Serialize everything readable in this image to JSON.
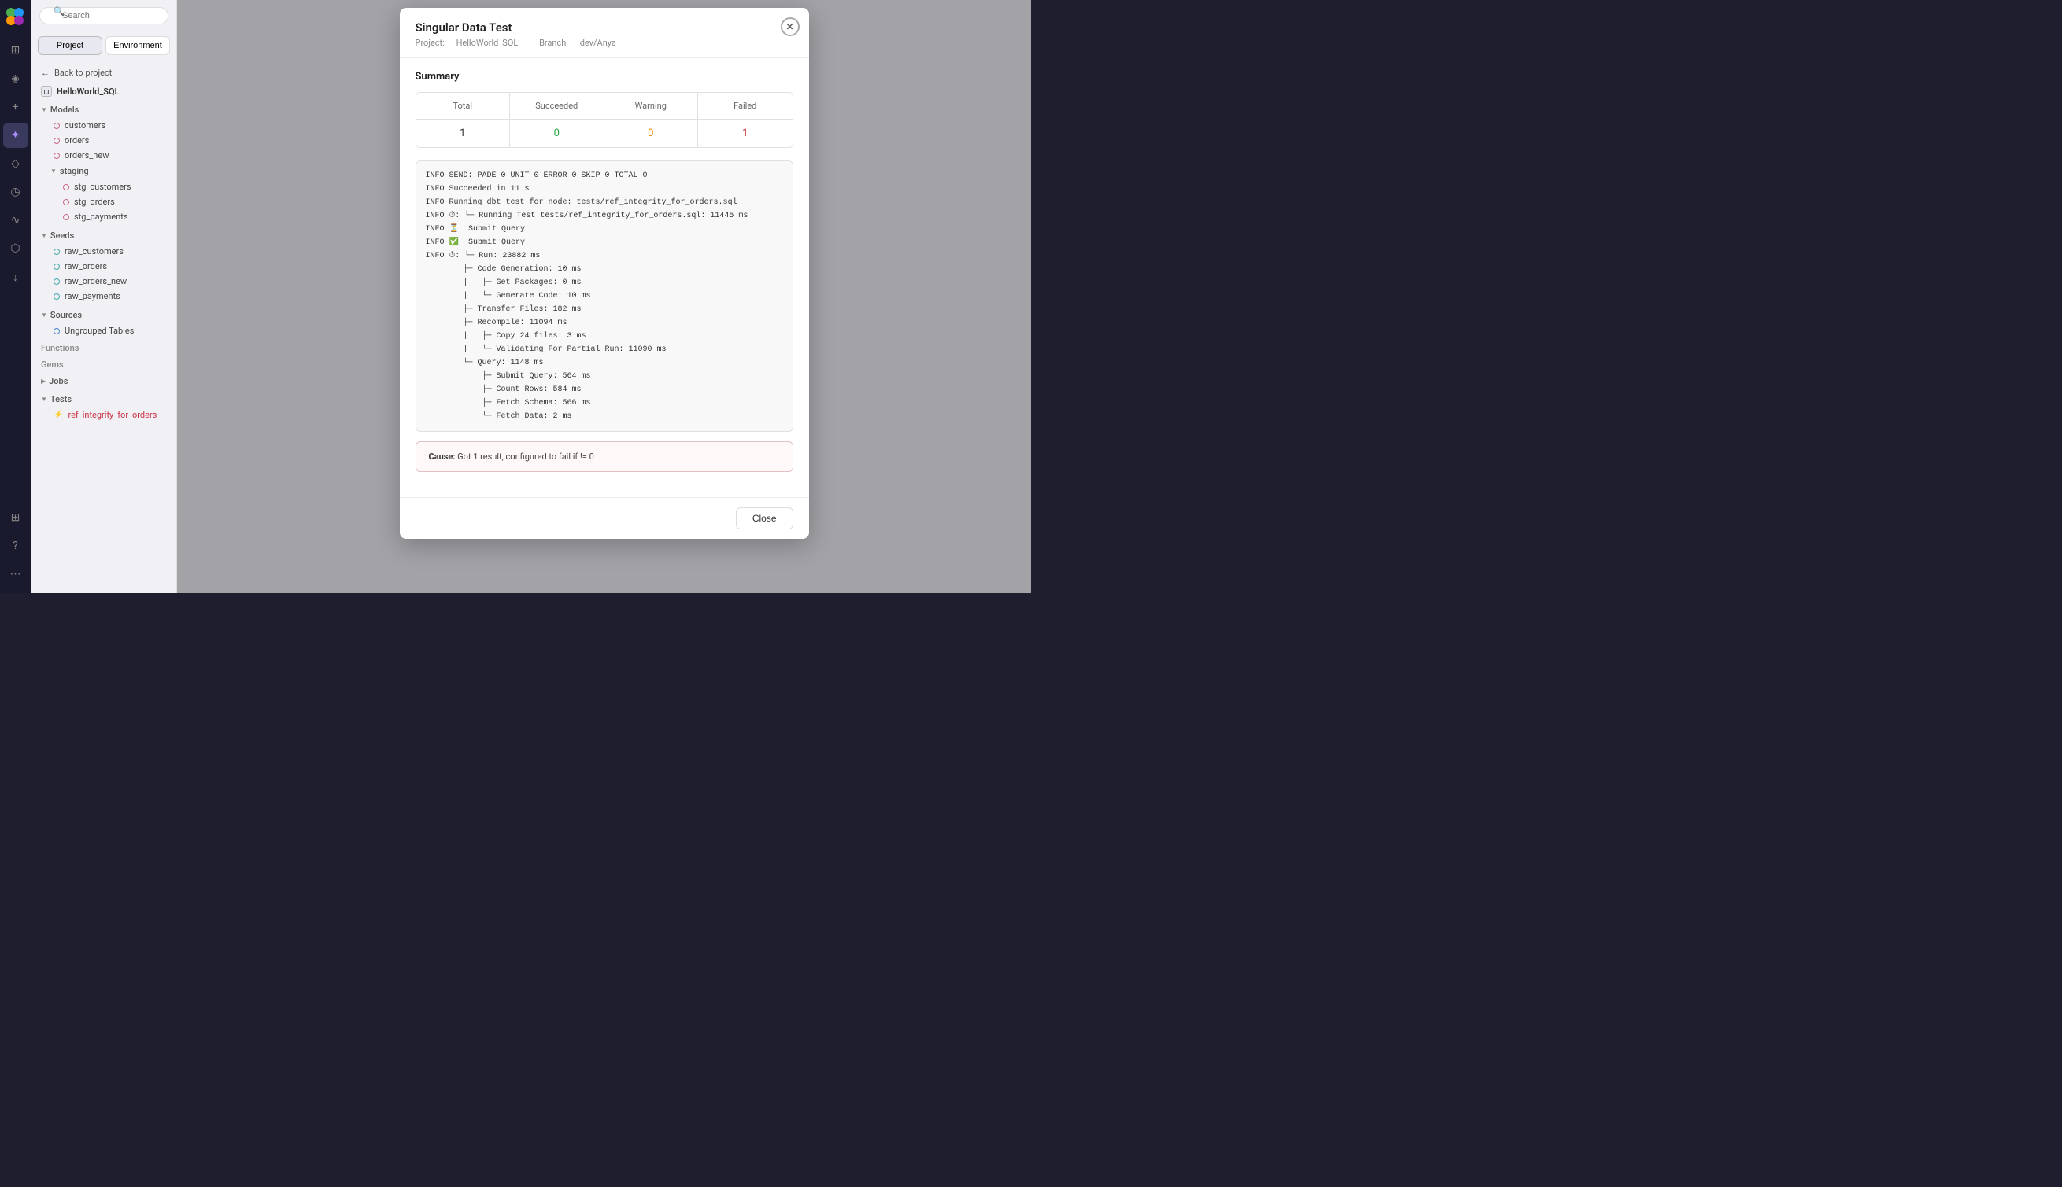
{
  "sidebar_icons": {
    "logo_label": "Matillion Logo",
    "items": [
      {
        "name": "home-icon",
        "glyph": "⊞",
        "active": false
      },
      {
        "name": "layers-icon",
        "glyph": "◈",
        "active": false
      },
      {
        "name": "add-icon",
        "glyph": "+",
        "active": false
      },
      {
        "name": "pipeline-icon",
        "glyph": "✦",
        "active": true
      },
      {
        "name": "tag-icon",
        "glyph": "◇",
        "active": false
      },
      {
        "name": "clock-icon",
        "glyph": "◷",
        "active": false
      },
      {
        "name": "activity-icon",
        "glyph": "∿",
        "active": false
      },
      {
        "name": "topology-icon",
        "glyph": "⬡",
        "active": false
      },
      {
        "name": "download-icon",
        "glyph": "↓",
        "active": false
      }
    ],
    "bottom_items": [
      {
        "name": "grid-icon",
        "glyph": "⊞"
      },
      {
        "name": "help-icon",
        "glyph": "?"
      },
      {
        "name": "more-icon",
        "glyph": "⋯"
      }
    ]
  },
  "search": {
    "placeholder": "Search",
    "label": "Search"
  },
  "tabs": {
    "project_label": "Project",
    "environment_label": "Environment"
  },
  "nav": {
    "back_label": "Back to project",
    "project_name": "HelloWorld_SQL"
  },
  "tree": {
    "models_label": "Models",
    "models_items": [
      "customers",
      "orders",
      "orders_new"
    ],
    "staging_label": "staging",
    "staging_items": [
      "stg_customers",
      "stg_orders",
      "stg_payments"
    ],
    "seeds_label": "Seeds",
    "seeds_items": [
      "raw_customers",
      "raw_orders",
      "raw_orders_new",
      "raw_payments"
    ],
    "sources_label": "Sources",
    "sources_items": [
      "Ungrouped Tables"
    ],
    "functions_label": "Functions",
    "gems_label": "Gems",
    "jobs_label": "Jobs",
    "tests_label": "Tests",
    "test_items": [
      "ref_integrity_for_orders"
    ]
  },
  "modal": {
    "title": "Singular Data Test",
    "project_label": "Project:",
    "project_value": "HelloWorld_SQL",
    "branch_label": "Branch:",
    "branch_value": "dev/Anya",
    "summary_label": "Summary",
    "table_headers": [
      "Total",
      "Succeeded",
      "Warning",
      "Failed"
    ],
    "table_values": [
      "1",
      "0",
      "0",
      "1"
    ],
    "log_text": "INFO SEND: PADE 0 UNIT 0 ERROR 0 SKIP 0 TOTAL 0\nINFO Succeeded in 11 s\nINFO Running dbt test for node: tests/ref_integrity_for_orders.sql\nINFO ⏱: └─ Running Test tests/ref_integrity_for_orders.sql: 11445 ms\nINFO ⏳  Submit Query\nINFO ✅  Submit Query\nINFO ⏱: └─ Run: 23882 ms\n        ├─ Code Generation: 10 ms\n        |   ├─ Get Packages: 0 ms\n        |   └─ Generate Code: 10 ms\n        ├─ Transfer Files: 182 ms\n        ├─ Recompile: 11094 ms\n        |   ├─ Copy 24 files: 3 ms\n        |   └─ Validating For Partial Run: 11090 ms\n        └─ Query: 1148 ms\n            ├─ Submit Query: 564 ms\n            ├─ Count Rows: 584 ms\n            ├─ Fetch Schema: 566 ms\n            └─ Fetch Data: 2 ms",
    "cause_label": "Cause:",
    "cause_text": "Got 1 result, configured to fail if != 0",
    "close_label": "Close"
  }
}
